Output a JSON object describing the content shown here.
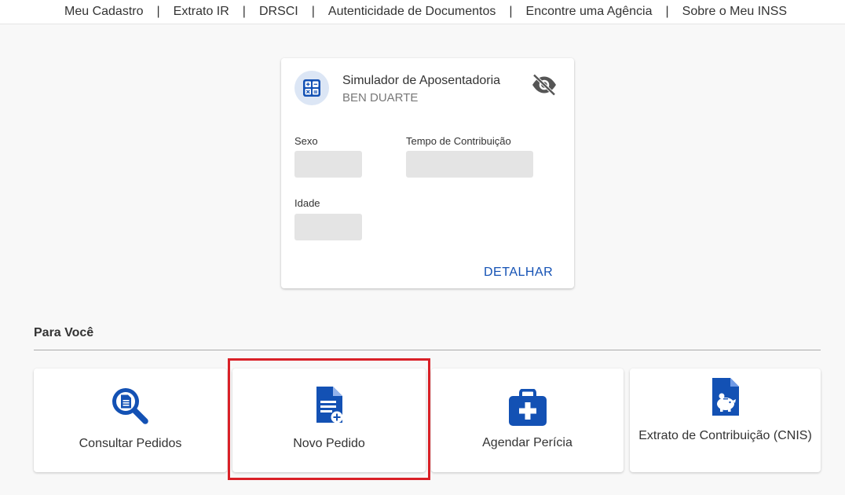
{
  "topnav": {
    "items": [
      "Meu Cadastro",
      "Extrato IR",
      "DRSCI",
      "Autenticidade de Documentos",
      "Encontre uma Agência",
      "Sobre o Meu INSS"
    ],
    "separator": "|"
  },
  "simulator": {
    "title": "Simulador de Aposentadoria",
    "user": "BEN DUARTE",
    "icon": "calculator-icon",
    "toggle_icon": "eye-off-icon",
    "fields": {
      "sexo_label": "Sexo",
      "tempo_label": "Tempo de Contribuição",
      "idade_label": "Idade"
    },
    "detail_link": "DETALHAR"
  },
  "para_voce": {
    "title": "Para Você",
    "tiles": [
      {
        "label": "Consultar Pedidos",
        "icon": "document-search-icon"
      },
      {
        "label": "Novo Pedido",
        "icon": "document-add-icon"
      },
      {
        "label": "Agendar Perícia",
        "icon": "medical-kit-icon"
      },
      {
        "label": "Extrato de Contribuição (CNIS)",
        "icon": "document-piggy-bank-icon"
      }
    ]
  },
  "colors": {
    "accent": "#1351b4",
    "highlight": "#d92027",
    "skeleton": "#e4e4e4",
    "background": "#f8f8f8"
  }
}
